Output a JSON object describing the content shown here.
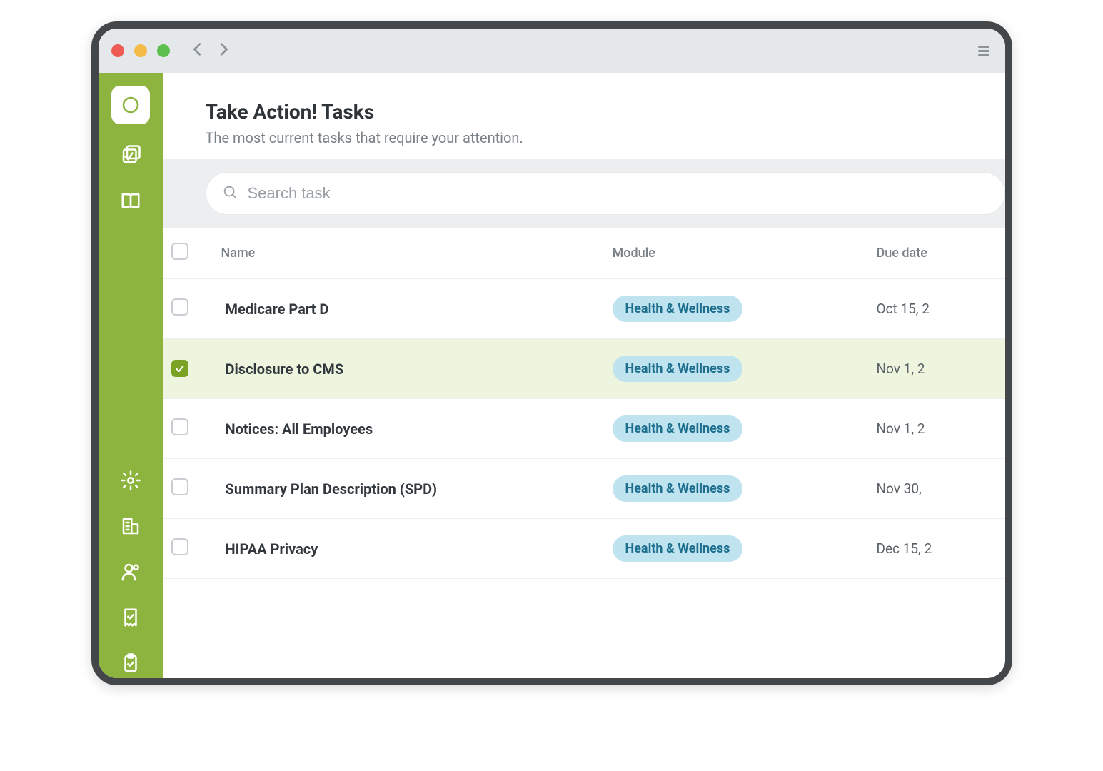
{
  "header": {
    "title": "Take Action! Tasks",
    "subtitle": "The most current tasks that require your attention."
  },
  "search": {
    "placeholder": "Search task",
    "value": ""
  },
  "columns": {
    "name": "Name",
    "module": "Module",
    "due": "Due date"
  },
  "tasks": [
    {
      "name": "Medicare Part D",
      "module": "Health & Wellness",
      "due": "Oct 15, 2",
      "checked": false
    },
    {
      "name": "Disclosure to CMS",
      "module": "Health & Wellness",
      "due": "Nov 1, 2",
      "checked": true
    },
    {
      "name": "Notices: All Employees",
      "module": "Health & Wellness",
      "due": "Nov 1, 2",
      "checked": false
    },
    {
      "name": "Summary Plan Description (SPD)",
      "module": "Health & Wellness",
      "due": "Nov 30,",
      "checked": false
    },
    {
      "name": "HIPAA Privacy",
      "module": "Health & Wellness",
      "due": "Dec 15, 2",
      "checked": false
    }
  ],
  "sidebar": {
    "top": [
      "dashboard",
      "tasks",
      "library"
    ],
    "bottom": [
      "settings",
      "company",
      "users",
      "receipts",
      "clipboard"
    ]
  }
}
